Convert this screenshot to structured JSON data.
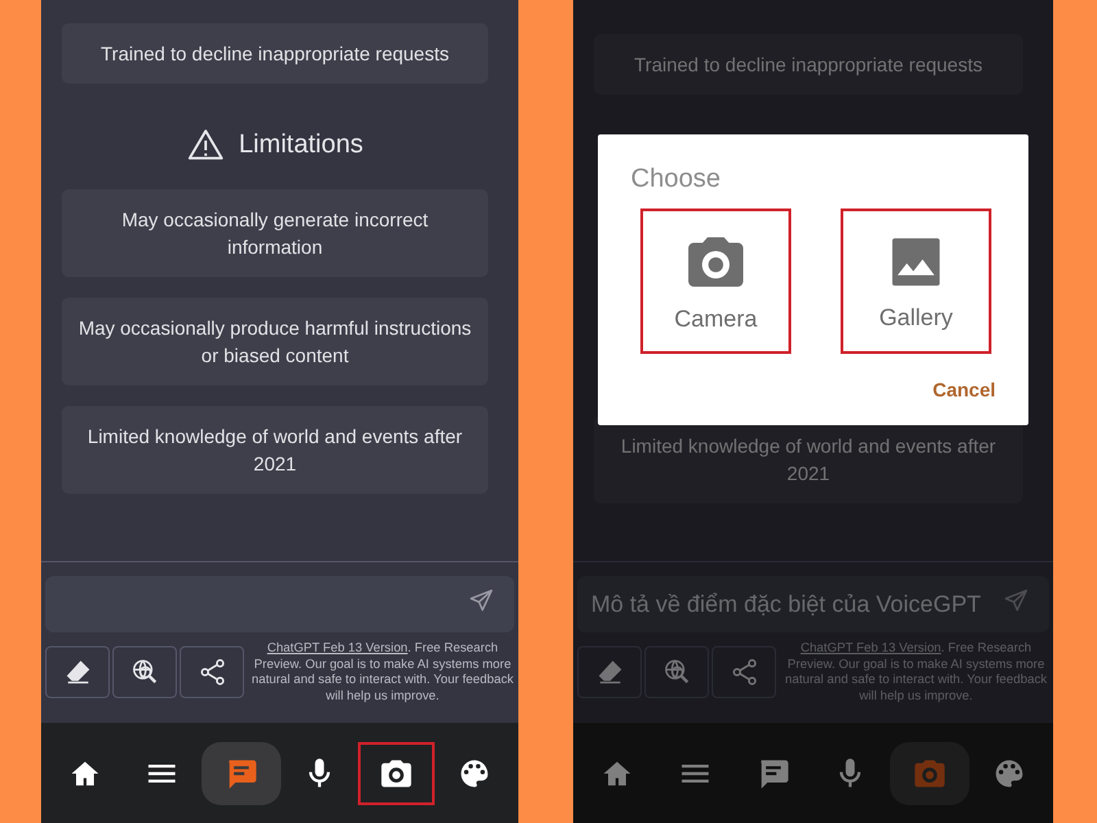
{
  "phones": [
    {
      "items": [
        {
          "kind": "card",
          "text": "Trained to decline inappropriate requests"
        },
        {
          "kind": "heading",
          "text": "Limitations"
        },
        {
          "kind": "card",
          "text": "May occasionally generate incorrect information"
        },
        {
          "kind": "card",
          "text": "May occasionally produce harmful instructions or biased content"
        },
        {
          "kind": "card",
          "text": "Limited knowledge of world and events after 2021"
        }
      ],
      "footer": {
        "link": "ChatGPT Feb 13 Version",
        "text": ". Free Research Preview. Our goal is to make AI systems more natural and safe to interact with. Your feedback will help us improve."
      },
      "nav": [
        {
          "selected": false,
          "highlighted": false
        },
        {
          "selected": false,
          "highlighted": false
        },
        {
          "selected": true,
          "highlighted": false
        },
        {
          "selected": false,
          "highlighted": false
        },
        {
          "selected": false,
          "highlighted": true
        },
        {
          "selected": false,
          "highlighted": false
        }
      ]
    },
    {
      "items": [
        {
          "kind": "card",
          "text": "Trained to decline inappropriate requests"
        },
        {
          "kind": "card",
          "text": "Limited knowledge of world and events after 2021"
        }
      ],
      "input": {
        "value": "Mô tả về điểm đặc biệt của VoiceGPT"
      },
      "footer": {
        "link": "ChatGPT Feb 13 Version",
        "text": ". Free Research Preview. Our goal is to make AI systems more natural and safe to interact with. Your feedback will help us improve."
      },
      "nav": [
        {
          "selected": false,
          "highlighted": false
        },
        {
          "selected": false,
          "highlighted": false
        },
        {
          "selected": false,
          "highlighted": false
        },
        {
          "selected": false,
          "highlighted": false
        },
        {
          "selected": true,
          "highlighted": false
        },
        {
          "selected": false,
          "highlighted": false
        }
      ],
      "dialog": {
        "title": "Choose",
        "options": [
          {
            "kind": "camera",
            "label": "Camera",
            "highlighted": true
          },
          {
            "kind": "gallery",
            "label": "Gallery",
            "highlighted": true
          }
        ],
        "cancel": "Cancel"
      }
    }
  ]
}
